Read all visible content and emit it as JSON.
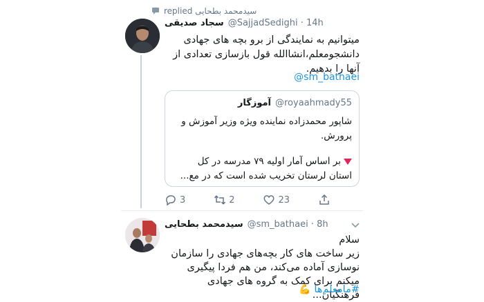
{
  "replied_line": "سیدمحمد بطحایی replied",
  "tweet1": {
    "name": "سجاد صدیقی",
    "handle": "@SajjadSedighi · 14h",
    "text": "میتوانیم به نمایندگی از برو بچه های جهادی دانشجومعلم،انشاالله قول بازسازی تعدادی از آنها را بدهیم.",
    "mention": "@sm_bathaei"
  },
  "quote": {
    "name": "آموزگار",
    "handle": "@royaahmady55",
    "text1": "شاپور محمدزاده نماینده ویژه وزیر آموزش و پرورش.",
    "text2": "بر اساس آمار اولیه ۷۹ مدرسه در کل استان لرستان تخریب شده است که در مع..."
  },
  "actions": {
    "reply_count": "3",
    "retweet_count": "2",
    "like_count": "23"
  },
  "tweet2": {
    "name": "سیدمحمد بطحایی",
    "handle": "@sm_bathaei · 8h",
    "text": "سلام\nزیر ساخت های کار بچه‌های جهادی را سازمان نوسازی آماده می‌کند، من هم فردا پیگیری میکنم برای کمک به گروه های جهادی فرهنگیان...",
    "hashtag": "#مامعلم‌ها",
    "emoji": "💪"
  },
  "icons": {
    "replied": "speech-bubble-icon",
    "reply": "reply-icon",
    "retweet": "retweet-icon",
    "like": "heart-icon",
    "share": "share-icon",
    "more": "chevron-down-icon"
  },
  "colors": {
    "link": "#1b95e0",
    "secondary_text": "#657786",
    "border": "#ccd6dd"
  }
}
